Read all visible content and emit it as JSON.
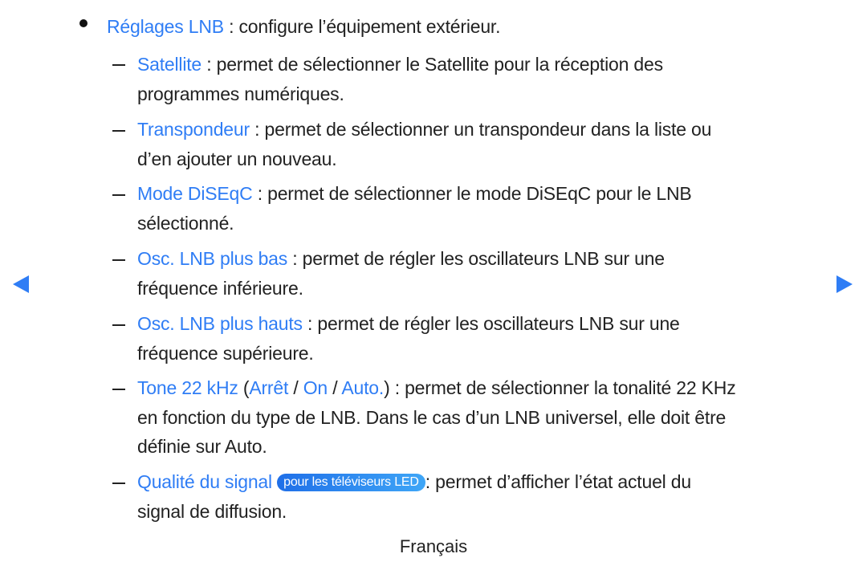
{
  "main_item": {
    "term": "Réglages LNB",
    "desc": " : configure l’équipement extérieur."
  },
  "sub_items": [
    {
      "term": "Satellite",
      "lines": [
        " : permet de sélectionner le Satellite pour la réception des",
        "programmes numériques."
      ]
    },
    {
      "term": "Transpondeur",
      "lines": [
        " : permet de sélectionner un transpondeur dans la liste ou",
        "d’en ajouter un nouveau."
      ]
    },
    {
      "term": "Mode DiSEqC",
      "lines": [
        " : permet de sélectionner le mode DiSEqC pour le LNB",
        "sélectionné."
      ]
    },
    {
      "term": "Osc. LNB plus bas",
      "lines": [
        " : permet de régler les oscillateurs LNB sur une",
        "fréquence inférieure."
      ]
    },
    {
      "term": "Osc. LNB plus hauts",
      "lines": [
        " : permet de régler les oscillateurs LNB sur une",
        "fréquence supérieure."
      ]
    },
    {
      "term": "Tone 22 kHz",
      "options": [
        "Arrêt",
        "On",
        "Auto."
      ],
      "lines": [
        ") : permet de sélectionner la tonalité 22 KHz",
        "en fonction du type de LNB. Dans le cas d’un LNB universel, elle doit être",
        "définie sur Auto."
      ]
    },
    {
      "term": "Qualité du signal",
      "badge": "pour les téléviseurs LED",
      "lines": [
        ": permet d’afficher l’état actuel du",
        "signal de diffusion."
      ]
    }
  ],
  "footer": "Français",
  "icons": {
    "prev": "triangle-left-icon",
    "next": "triangle-right-icon"
  }
}
